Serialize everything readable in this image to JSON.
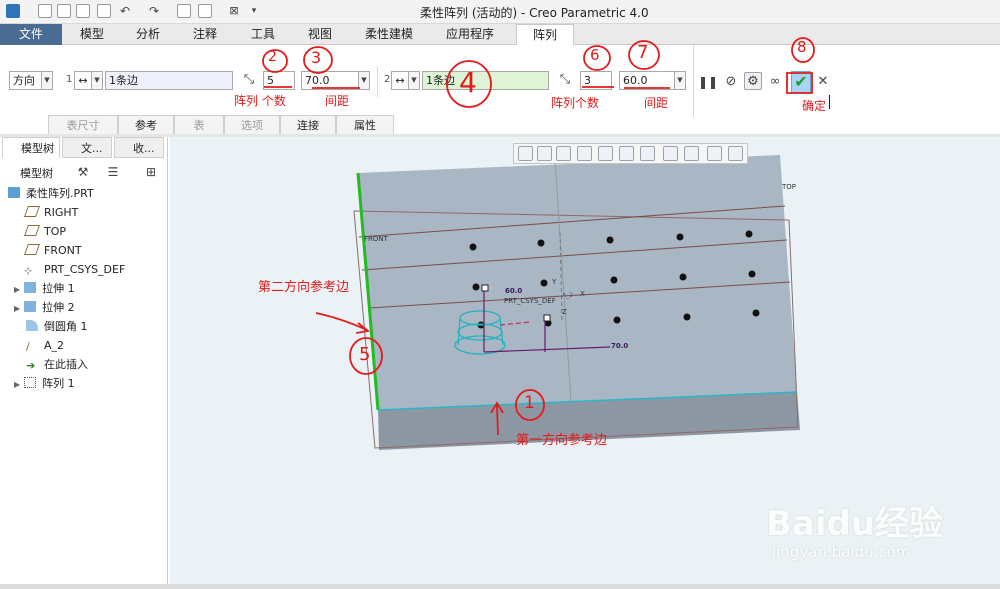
{
  "app": {
    "window_title": "柔性阵列 (活动的) - Creo Parametric 4.0"
  },
  "ribbon_tabs": [
    {
      "label": "文件"
    },
    {
      "label": "模型"
    },
    {
      "label": "分析"
    },
    {
      "label": "注释"
    },
    {
      "label": "工具"
    },
    {
      "label": "视图"
    },
    {
      "label": "柔性建模"
    },
    {
      "label": "应用程序"
    },
    {
      "label": "阵列"
    }
  ],
  "pattern_toolbar": {
    "type_select": "方向",
    "dir1": {
      "index_label": "1",
      "reference": "1条边",
      "count": "5",
      "spacing": "70.0"
    },
    "dir2": {
      "index_label": "2",
      "reference": "1条边",
      "count": "3",
      "spacing": "60.0"
    },
    "subtabs": [
      "表尺寸",
      "参考",
      "表",
      "选项",
      "连接",
      "属性"
    ]
  },
  "annotations": {
    "num2": "2",
    "num3": "3",
    "num4": "4",
    "num5": "5",
    "num6": "6",
    "num7": "7",
    "num8": "8",
    "num1": "1",
    "count_label_1": "阵列 个数",
    "spacing_label_1": "间距",
    "count_label_2": "阵列个数",
    "spacing_label_2": "间距",
    "confirm": "确定",
    "second_direction": "第二方向参考边",
    "first_direction": "第一方向参考边"
  },
  "left_panel": {
    "tabs": [
      "模型树",
      "文...",
      "收..."
    ],
    "header": "模型树",
    "tree": [
      {
        "label": "柔性阵列.PRT"
      },
      {
        "label": "RIGHT"
      },
      {
        "label": "TOP"
      },
      {
        "label": "FRONT"
      },
      {
        "label": "PRT_CSYS_DEF"
      },
      {
        "label": "拉伸 1"
      },
      {
        "label": "拉伸 2"
      },
      {
        "label": "倒圆角 1"
      },
      {
        "label": "A_2"
      },
      {
        "label": "在此插入"
      },
      {
        "label": "阵列 1"
      }
    ]
  },
  "model_labels": {
    "top_plane": "TOP",
    "front_plane": "FRONT",
    "csys": "PRT_CSYS_DEF",
    "dim_60": "60.0",
    "dim_70": "70.0",
    "axis_z": "Z",
    "axis_y": "Y",
    "axis_x": "X",
    "axis_label": "A_2"
  },
  "watermark": {
    "brand": "Baidu经验",
    "url": "jingyan.baidu.com"
  },
  "colors": {
    "file_tab": "#4a6c93",
    "model_top_face": "#a9b6c3",
    "model_side_face": "#8d97a4",
    "annotation_red": "#e21b1b",
    "edge_green": "#22bb22",
    "edge_cyan": "#2ab7c8"
  }
}
